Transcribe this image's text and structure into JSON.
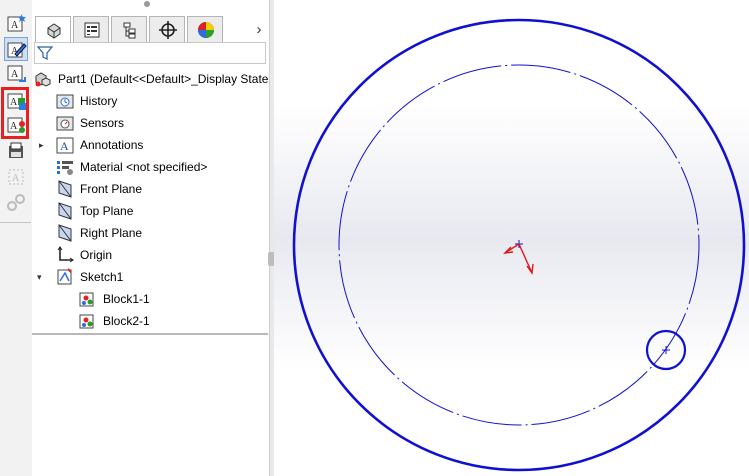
{
  "tree": {
    "root": {
      "label": "Part1  (Default<<Default>_Display State"
    },
    "items": [
      {
        "label": "History"
      },
      {
        "label": "Sensors"
      },
      {
        "label": "Annotations"
      },
      {
        "label": "Material <not specified>"
      },
      {
        "label": "Front Plane"
      },
      {
        "label": "Top Plane"
      },
      {
        "label": "Right Plane"
      },
      {
        "label": "Origin"
      },
      {
        "label": "Sketch1"
      },
      {
        "label": "Block1-1"
      },
      {
        "label": "Block2-1"
      }
    ]
  },
  "tabs": {
    "expand_arrow": "›"
  },
  "colors": {
    "highlight": "#e6201e",
    "sketch_blue": "#1010d0",
    "origin_red": "#e01818"
  }
}
